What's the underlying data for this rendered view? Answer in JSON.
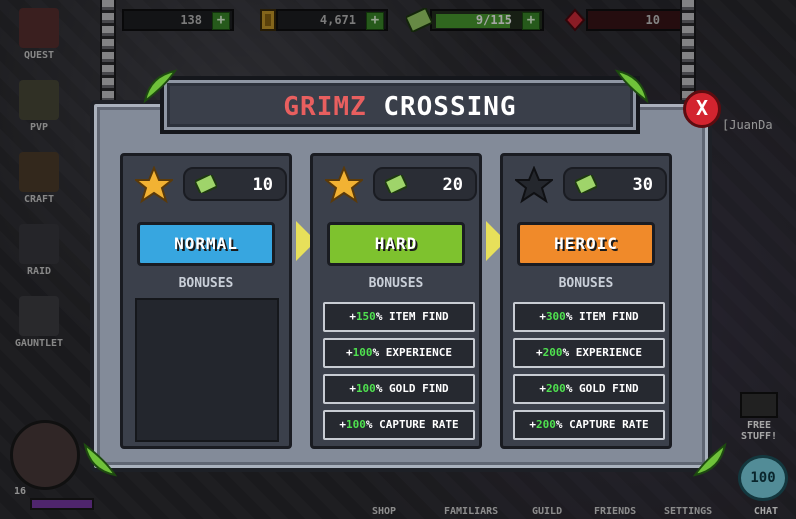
{
  "topbar": {
    "gold": "138",
    "coins": "4,671",
    "keys": "9/115",
    "gems": "10"
  },
  "left_menu": [
    "QUEST",
    "PVP",
    "CRAFT",
    "RAID",
    "GAUNTLET"
  ],
  "bottom_menu": [
    "SHOP",
    "FAMILIARS",
    "GUILD",
    "FRIENDS",
    "SETTINGS"
  ],
  "player": {
    "level": "16",
    "name_partial": "[JuanDa"
  },
  "free_stuff": {
    "line1": "FREE",
    "line2": "STUFF!"
  },
  "chat": {
    "count": "100",
    "label": "CHAT"
  },
  "dialog": {
    "title_part1": "GRIMZ",
    "title_part2": "CROSSING",
    "close_label": "X",
    "bonuses_header": "BONUSES",
    "difficulties": [
      {
        "name": "NORMAL",
        "cost": "10",
        "color": "#37a6e0",
        "star": "filled",
        "bonuses": []
      },
      {
        "name": "HARD",
        "cost": "20",
        "color": "#7ec22e",
        "star": "filled",
        "bonuses": [
          {
            "pct": "150",
            "text": "% ITEM FIND"
          },
          {
            "pct": "100",
            "text": "% EXPERIENCE"
          },
          {
            "pct": "100",
            "text": "% GOLD FIND"
          },
          {
            "pct": "100",
            "text": "% CAPTURE RATE"
          }
        ]
      },
      {
        "name": "HEROIC",
        "cost": "30",
        "color": "#f08a2a",
        "star": "empty",
        "bonuses": [
          {
            "pct": "300",
            "text": "% ITEM FIND"
          },
          {
            "pct": "200",
            "text": "% EXPERIENCE"
          },
          {
            "pct": "200",
            "text": "% GOLD FIND"
          },
          {
            "pct": "200",
            "text": "% CAPTURE RATE"
          }
        ]
      }
    ]
  }
}
